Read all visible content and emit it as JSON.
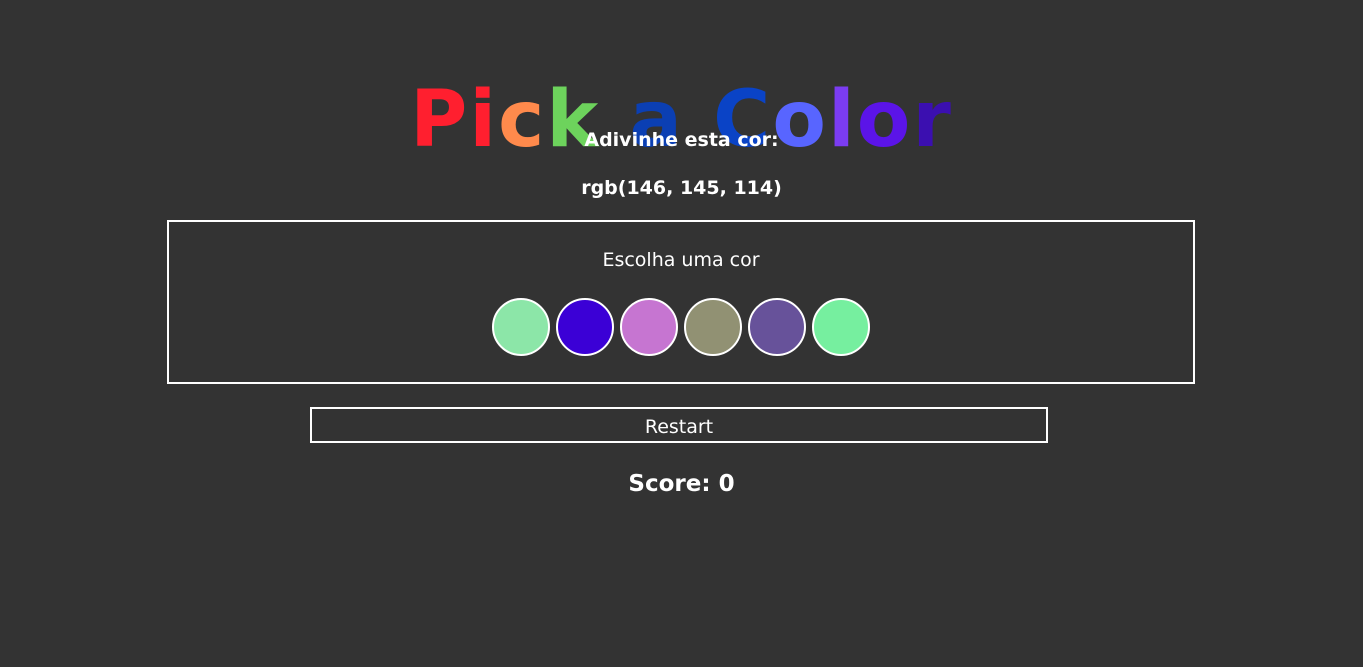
{
  "title": {
    "letters": [
      {
        "char": "P",
        "color": "#ff1f2f"
      },
      {
        "char": "i",
        "color": "#ff1f2f"
      },
      {
        "char": "c",
        "color": "#ff8a4c"
      },
      {
        "char": "k",
        "color": "#6dd35c"
      },
      {
        "char": " ",
        "color": "#ffffff"
      },
      {
        "char": "a",
        "color": "#0b3fb3"
      },
      {
        "char": " ",
        "color": "#ffffff"
      },
      {
        "char": "C",
        "color": "#0a43c6"
      },
      {
        "char": "o",
        "color": "#5865ff"
      },
      {
        "char": "l",
        "color": "#7b3cf2"
      },
      {
        "char": "o",
        "color": "#5b14e8"
      },
      {
        "char": "r",
        "color": "#3b0fb0"
      }
    ]
  },
  "guess_label": "Adivinhe esta cor:",
  "rgb_text": "rgb(146, 145, 114)",
  "board": {
    "label": "Escolha uma cor",
    "balls": [
      "#8ce6a8",
      "#3b00d6",
      "#c675d1",
      "#919173",
      "#67529a",
      "#76ef9f"
    ]
  },
  "restart_label": "Restart",
  "score_text": "Score: 0"
}
